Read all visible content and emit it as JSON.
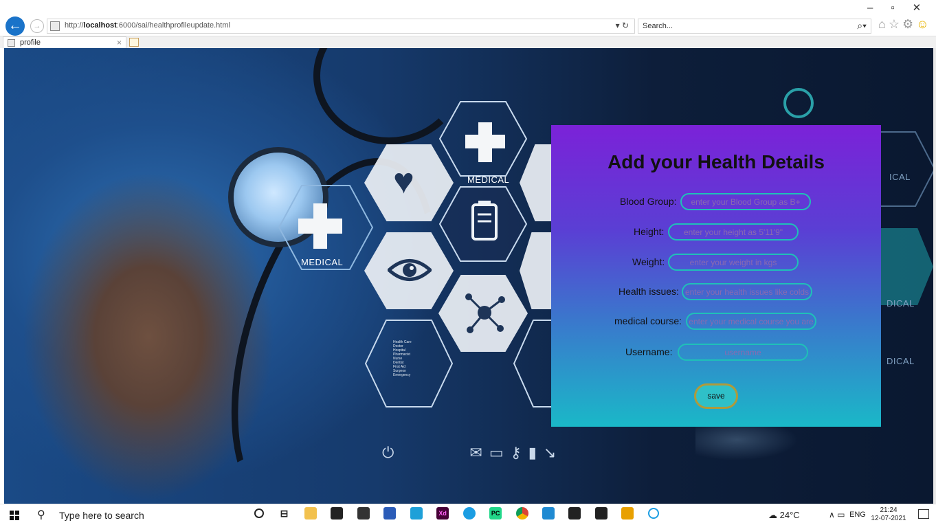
{
  "browser": {
    "url_prefix": "http://",
    "url_host": "localhost",
    "url_rest": ":6000/sai/healthprofileupdate.html",
    "search_placeholder": "Search...",
    "tab_title": "profile"
  },
  "hero": {
    "hex_label_1": "MEDICAL",
    "hex_label_2": "MEDICAL",
    "hex_label_3": "ICAL",
    "hex_label_4": "DICAL",
    "hex_label_5": "DICAL",
    "hex_list": [
      "Health Care",
      "Doctor",
      "Hospital",
      "Pharmacist",
      "Nurse",
      "Dentist",
      "First Aid",
      "Surgeon",
      "Emergency"
    ]
  },
  "form": {
    "title": "Add your Health Details",
    "fields": [
      {
        "label": "Blood Group:",
        "placeholder": "enter your Blood Group as B+"
      },
      {
        "label": "Height:",
        "placeholder": "enter your height as 5'11'9\""
      },
      {
        "label": "Weight:",
        "placeholder": "enter your weight in kgs"
      },
      {
        "label": "Health issues:",
        "placeholder": "enter your health issues like colds"
      },
      {
        "label": "medical course:",
        "placeholder": "enter your medical course you are"
      },
      {
        "label": "Username:",
        "placeholder": "username"
      }
    ],
    "save_label": "save"
  },
  "taskbar": {
    "search_text": "Type here to search",
    "weather": "24°C",
    "language": "ENG",
    "time": "21:24",
    "date": "12-07-2021"
  },
  "icons": [
    "back-arrow-icon",
    "forward-arrow-icon",
    "page-icon",
    "refresh-icon",
    "search-icon",
    "home-icon",
    "star-icon",
    "gear-icon",
    "smiley-icon",
    "close-icon",
    "windows-start-icon",
    "cortana-icon",
    "task-view-icon",
    "file-explorer-icon",
    "store-icon",
    "mail-icon",
    "weather-icon",
    "notification-icon"
  ]
}
